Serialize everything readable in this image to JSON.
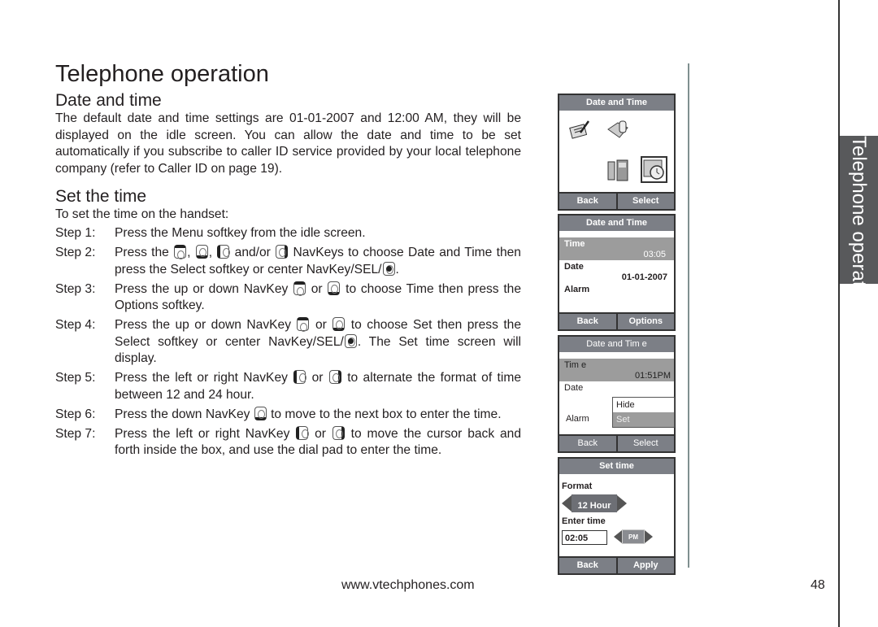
{
  "page": {
    "title": "Telephone operation",
    "side_tab": "Telephone operation",
    "footer_url": "www.vtechphones.com",
    "page_number": "48"
  },
  "section1": {
    "title": "Date and time",
    "body": "The default date and time settings are 01-01-2007 and 12:00 AM, they will be displayed on the idle screen. You can allow the date and time to be set automatically if you subscribe to caller ID service provided by your local telephone company (refer to Caller ID on page 19)."
  },
  "section2": {
    "title": "Set the time",
    "intro": "To set the time on the handset:",
    "steps": [
      {
        "label": "Step 1:",
        "parts": [
          "Press the Menu softkey from the idle screen."
        ]
      },
      {
        "label": "Step 2:",
        "parts": [
          "Press the ",
          ", ",
          ", ",
          " and/or ",
          " NavKeys to choose Date and Time then press the Select softkey or center NavKey/SEL/",
          "."
        ]
      },
      {
        "label": "Step 3:",
        "parts": [
          "Press the up or down NavKey ",
          " or ",
          " to choose Time then press the Options softkey."
        ]
      },
      {
        "label": "Step 4:",
        "parts": [
          "Press the up or down NavKey ",
          " or ",
          " to choose Set then press the Select softkey or center NavKey/SEL/",
          ". The Set time screen will display."
        ]
      },
      {
        "label": "Step 5:",
        "parts": [
          "Press the left or right NavKey ",
          " or ",
          " to alternate the format of time between 12 and 24 hour."
        ]
      },
      {
        "label": "Step 6:",
        "parts": [
          "Press the down NavKey ",
          " to move to the next box to enter the time."
        ]
      },
      {
        "label": "Step 7:",
        "parts": [
          "Press the left or right NavKey ",
          " or ",
          " to move the cursor back and forth inside the box, and use the dial pad to enter the time."
        ]
      }
    ]
  },
  "screens": {
    "menu": {
      "header": "Date and Time",
      "icons": [
        "notepad-icon",
        "folder-icon",
        "handset-base-icon",
        "calendar-clock-icon"
      ],
      "selected_icon": "calendar-clock-icon",
      "left_softkey": "Back",
      "right_softkey": "Select"
    },
    "date_time": {
      "header": "Date and Time",
      "rows": [
        {
          "label": "Time",
          "value": "03:05",
          "highlighted": true
        },
        {
          "label": "Date",
          "value": "01-01-2007",
          "highlighted": false
        },
        {
          "label": "Alarm",
          "value": "",
          "highlighted": false
        }
      ],
      "left_softkey": "Back",
      "right_softkey": "Options"
    },
    "options": {
      "header": "Date and Tim e",
      "rows": [
        {
          "label": "Tim e",
          "value": "01:51PM"
        },
        {
          "label": "Date",
          "value": ""
        },
        {
          "label": "Alarm",
          "value": ""
        }
      ],
      "menu_items": [
        "Hide",
        "Set"
      ],
      "selected_item": "Set",
      "left_softkey": "Back",
      "right_softkey": "Select"
    },
    "set_time": {
      "header": "Set time",
      "format_label": "Format",
      "format_value": "12 Hour",
      "enter_time_label": "Enter time",
      "time_value": "02:05",
      "ampm_value": "PM",
      "left_softkey": "Back",
      "right_softkey": "Apply"
    }
  },
  "colors": {
    "screen_header": "#7c7f86",
    "highlight_row": "#9c9c9c",
    "side_tab": "#58595b",
    "text": "#231f20"
  }
}
